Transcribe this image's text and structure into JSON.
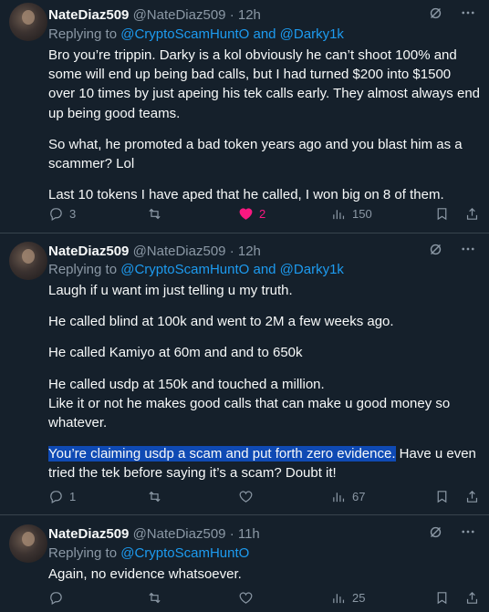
{
  "tweets": [
    {
      "name": "NateDiaz509",
      "handle": "@NateDiaz509",
      "dot": "·",
      "time": "12h",
      "replying_prefix": "Replying to",
      "replying_targets": "@CryptoScamHuntO and @Darky1k",
      "paragraphs": [
        "Bro you’re trippin. Darky is a kol obviously he can’t shoot 100% and some will end up being bad calls, but I had turned $200 into $1500 over 10 times by just apeing his tek calls early. They almost always end up being good teams.",
        "So what, he promoted a bad token years ago and you blast him as a scammer? Lol",
        "Last 10 tokens I have aped that he called, I won big on 8 of them."
      ],
      "replies": "3",
      "reposts": "",
      "likes": "2",
      "views": "150",
      "liked": true
    },
    {
      "name": "NateDiaz509",
      "handle": "@NateDiaz509",
      "dot": "·",
      "time": "12h",
      "replying_prefix": "Replying to",
      "replying_targets": "@CryptoScamHuntO and @Darky1k",
      "paragraphs": [
        "Laugh if u want im just telling u my truth.",
        "He called blind at 100k and went to 2M a few weeks ago.",
        "He called Kamiyo at 60m and and to 650k",
        "He called usdp at 150k and touched a million.\nLike it or not he makes good calls that can make u good money so whatever."
      ],
      "highlight": "You’re claiming usdp a scam and put forth zero evidence.",
      "after_highlight": " Have u even tried the tek before saying it’s a scam? Doubt it!",
      "replies": "1",
      "reposts": "",
      "likes": "",
      "views": "67",
      "liked": false
    },
    {
      "name": "NateDiaz509",
      "handle": "@NateDiaz509",
      "dot": "·",
      "time": "11h",
      "replying_prefix": "Replying to",
      "replying_targets": "@CryptoScamHuntO",
      "paragraphs": [
        "Again, no evidence whatsoever."
      ],
      "replies": "",
      "reposts": "",
      "likes": "",
      "views": "25",
      "liked": false
    }
  ],
  "icons": {
    "grok": "grok-icon",
    "more": "more-icon",
    "reply": "reply-icon",
    "repost": "repost-icon",
    "like": "heart-icon",
    "views": "views-icon",
    "bookmark": "bookmark-icon",
    "share": "share-icon"
  },
  "colors": {
    "background": "#15202b",
    "mention": "#1d9bf0",
    "like_active": "#f91880",
    "highlight": "#0f4ab4"
  }
}
